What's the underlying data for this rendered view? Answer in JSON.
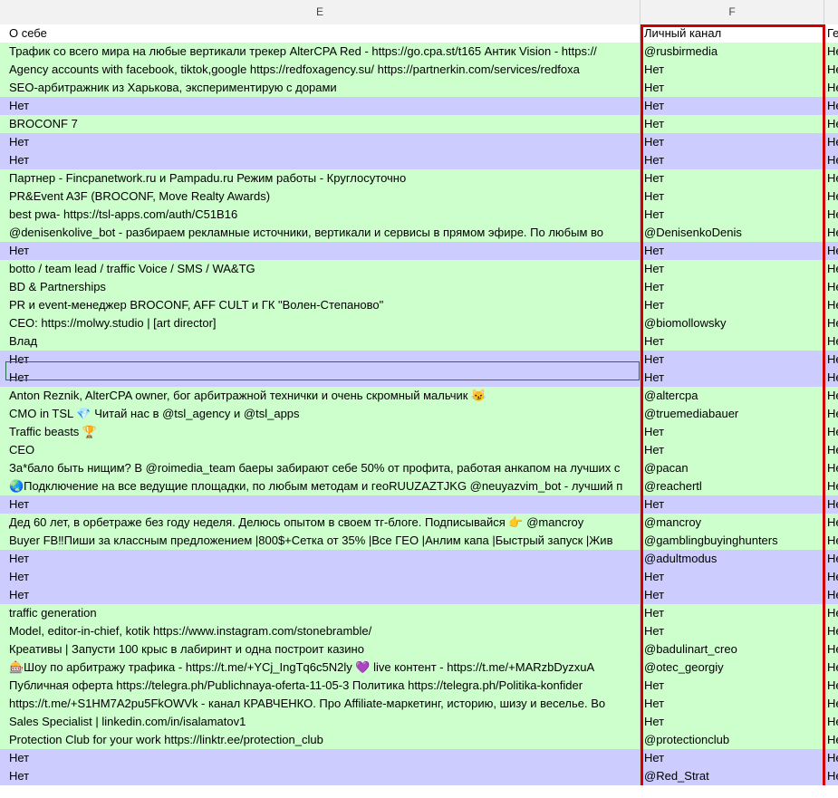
{
  "columns": {
    "e": "E",
    "f": "F"
  },
  "rows": [
    {
      "e": "О себе",
      "f": "Личный канал",
      "g": "Ге",
      "style": "hdr"
    },
    {
      "e": "Трафик со всего мира на любые вертикали трекер AlterCPA Red - https://go.cpa.st/t165 Антик Vision - https://",
      "f": "@rusbirmedia",
      "g": "Не",
      "style": "green"
    },
    {
      "e": "Agency accounts with facebook, tiktok,google https://redfoxagency.su/ https://partnerkin.com/services/redfoxa",
      "f": "Нет",
      "g": "Не",
      "style": "green"
    },
    {
      "e": "SEO-арбитражник из Харькова, экспериментирую с дорами",
      "f": "Нет",
      "g": "Не",
      "style": "green"
    },
    {
      "e": "Нет",
      "f": "Нет",
      "g": "Не",
      "style": "purple"
    },
    {
      "e": "BROCONF 7",
      "f": "Нет",
      "g": "Не",
      "style": "green"
    },
    {
      "e": "Нет",
      "f": "Нет",
      "g": "Не",
      "style": "purple",
      "marker": true
    },
    {
      "e": "Нет",
      "f": "Нет",
      "g": "Не",
      "style": "purple"
    },
    {
      "e": "Партнер - Fincpanetwork.ru и Pampadu.ru Режим работы - Круглосуточно",
      "f": "Нет",
      "g": "Не",
      "style": "green"
    },
    {
      "e": "PR&Event A3F (BROCONF, Move Realty Awards)",
      "f": "Нет",
      "g": "Не",
      "style": "green"
    },
    {
      "e": "best pwa- https://tsl-apps.com/auth/C51B16",
      "f": "Нет",
      "g": "Не",
      "style": "green"
    },
    {
      "e": "@denisenkolive_bot - разбираем рекламные источники, вертикали и сервисы в прямом эфире. По любым во",
      "f": "@DenisenkoDenis",
      "g": "Не",
      "style": "green"
    },
    {
      "e": "Нет",
      "f": "Нет",
      "g": "Не",
      "style": "purple"
    },
    {
      "e": "botto / team lead / traffic Voice / SMS / WA&TG",
      "f": "Нет",
      "g": "Не",
      "style": "green"
    },
    {
      "e": "BD & Partnerships",
      "f": "Нет",
      "g": "Не",
      "style": "green"
    },
    {
      "e": "PR и event-менеджер BROCONF, AFF CULT и ГК \"Волен-Степаново\"",
      "f": "Нет",
      "g": "Не",
      "style": "green"
    },
    {
      "e": "CEO: https://molwy.studio | [art director]",
      "f": "@biomollowsky",
      "g": "Не",
      "style": "green"
    },
    {
      "e": "Влад",
      "f": "Нет",
      "g": "Не",
      "style": "green"
    },
    {
      "e": "Нет",
      "f": "Нет",
      "g": "Не",
      "style": "purple"
    },
    {
      "e": "Нет",
      "f": "Нет",
      "g": "Не",
      "style": "purple"
    },
    {
      "e": "Anton Reznik, AlterCPA owner, бог арбитражной технички и очень скромный мальчик 😼",
      "f": "@altercpa",
      "g": "Не",
      "style": "green"
    },
    {
      "e": "CMO in TSL 💎 Читай нас в @tsl_agency и @tsl_apps",
      "f": "@truemediabauer",
      "g": "Не",
      "style": "green"
    },
    {
      "e": "Traffic beasts 🏆",
      "f": "Нет",
      "g": "Не",
      "style": "green"
    },
    {
      "e": "CEO",
      "f": "Нет",
      "g": "Не",
      "style": "green"
    },
    {
      "e": "За*бало быть нищим? В @roimedia_team баеры забирают себе 50% от профита, работая анкапом на лучших с",
      "f": "@pacan",
      "g": "Не",
      "style": "green"
    },
    {
      "e": "🌏Подключение на все ведущие площадки, по любым методам и гeoRUUZAZTJKG @neuyazvim_bot - лучший п",
      "f": "@reachertl",
      "g": "Не",
      "style": "green"
    },
    {
      "e": "Нет",
      "f": "Нет",
      "g": "Не",
      "style": "purple"
    },
    {
      "e": "Дед 60 лет, в орбетраже без году неделя. Делюсь опытом в своем тг-блоге. Подписывайся 👉 @mancroy",
      "f": "@mancroy",
      "g": "Не",
      "style": "green"
    },
    {
      "e": "Buyer FB‼Пиши за классным предложением |800$+Сетка от 35% |Все ГЕО |Анлим капа |Быстрый запуск |Жив",
      "f": "@gamblingbuyinghunters",
      "g": "Не",
      "style": "green"
    },
    {
      "e": "Нет",
      "f": "@adultmodus",
      "g": "Не",
      "style": "purple"
    },
    {
      "e": "Нет",
      "f": "Нет",
      "g": "Не",
      "style": "purple"
    },
    {
      "e": "Нет",
      "f": "Нет",
      "g": "Не",
      "style": "purple",
      "marker": true
    },
    {
      "e": "traffic generation",
      "f": "Нет",
      "g": "Не",
      "style": "green"
    },
    {
      "e": "Model, editor-in-chief, kotik https://www.instagram.com/stonebramble/",
      "f": "Нет",
      "g": "Не",
      "style": "green"
    },
    {
      "e": "Креативы | Запусти 100 крыс в лабиринт и одна построит казино",
      "f": "@badulinart_creo",
      "g": "Не",
      "style": "green"
    },
    {
      "e": "🎰Шоу по арбитражу трафика - https://t.me/+YCj_IngTq6c5N2ly 💜 live контент - https://t.me/+MARzbDyzxuA",
      "f": "@otec_georgiy",
      "g": "Не",
      "style": "green"
    },
    {
      "e": "Публичная оферта https://telegra.ph/Publichnaya-oferta-11-05-3 Политика https://telegra.ph/Politika-konfider",
      "f": "Нет",
      "g": "Не",
      "style": "green"
    },
    {
      "e": "https://t.me/+S1HM7A2pu5FkOWVk - канал КРАВЧЕНКО. Про Affiliate-маркетинг, историю, шизу и веселье. Во",
      "f": "Нет",
      "g": "Не",
      "style": "green"
    },
    {
      "e": "Sales Specialist | linkedin.com/in/isalamatov1",
      "f": "Нет",
      "g": "Не",
      "style": "green"
    },
    {
      "e": "Protection Club for your work https://linktr.ee/protection_club",
      "f": "@protectionclub",
      "g": "Не",
      "style": "green"
    },
    {
      "e": "Нет",
      "f": "Нет",
      "g": "Не",
      "style": "purple"
    },
    {
      "e": "Нет",
      "f": "@Red_Strat",
      "g": "Не",
      "style": "purple"
    }
  ]
}
